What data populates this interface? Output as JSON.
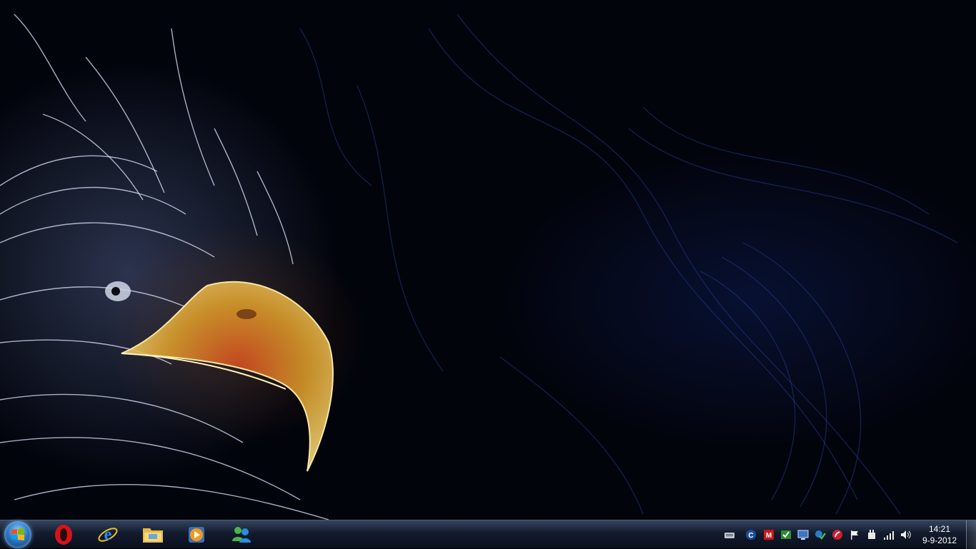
{
  "taskbar": {
    "start_button": {
      "icon": "windows-logo-icon"
    },
    "pinned_apps": [
      {
        "name": "opera",
        "icon": "opera-icon"
      },
      {
        "name": "internet-explorer",
        "icon": "internet-explorer-icon"
      },
      {
        "name": "windows-explorer",
        "icon": "folder-icon"
      },
      {
        "name": "media-player",
        "icon": "media-player-icon"
      },
      {
        "name": "messenger",
        "icon": "messenger-icon"
      }
    ],
    "tray_icons": [
      "keyboard-icon",
      "c-app-icon",
      "m-app-icon",
      "green-check-icon",
      "network-monitor-icon",
      "security-check-icon",
      "red-app-icon",
      "action-center-flag-icon",
      "power-plug-icon",
      "signal-strength-icon",
      "volume-icon"
    ],
    "clock": {
      "time": "14:21",
      "date": "9-9-2012"
    }
  },
  "colors": {
    "taskbar": "#14203a",
    "accent": "#2a78c8",
    "wallpaper_bg": "#02040c"
  }
}
